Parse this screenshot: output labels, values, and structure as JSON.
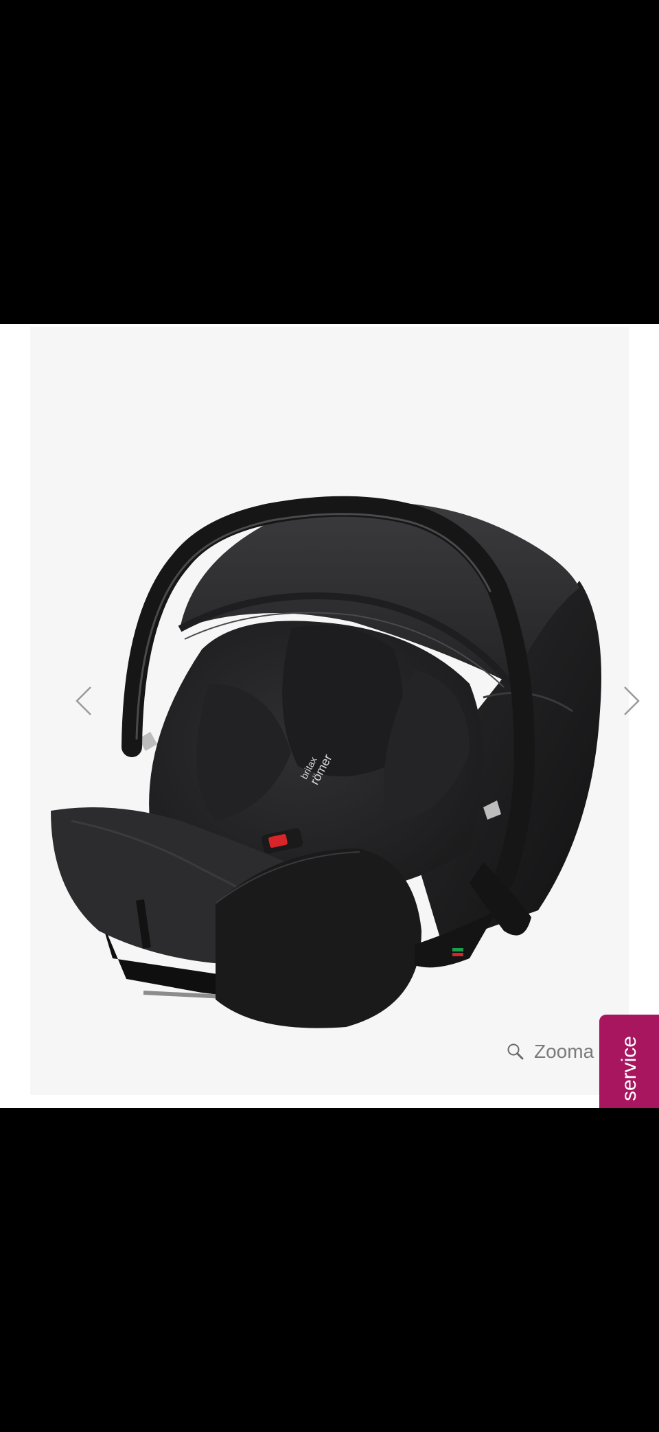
{
  "gallery": {
    "image_alt": "Britax Römer infant car seat",
    "seat_brand_lines": [
      "britax",
      "römer"
    ],
    "prev_icon": "chevron-left-icon",
    "next_icon": "chevron-right-icon",
    "zoom_icon": "magnifier-icon",
    "zoom_label": "Zooma"
  },
  "service_tab": {
    "label": "service",
    "color": "#a7165f"
  },
  "colors": {
    "background": "#000000",
    "image_bg": "#f6f6f6",
    "seat": "#262628",
    "shell": "#1b1b1c",
    "buckle": "#d9242a"
  }
}
